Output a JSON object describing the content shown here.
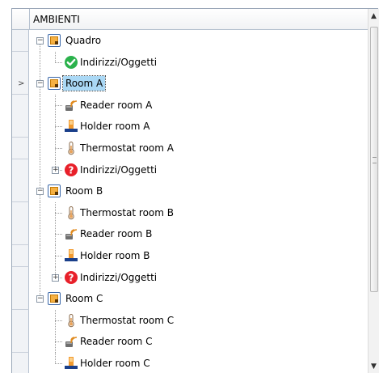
{
  "column_header": "AMBIENTI",
  "rows": [
    {
      "label": "Quadro",
      "kind": "room",
      "level": 0,
      "expanded": true,
      "selected": false
    },
    {
      "label": "Indirizzi/Oggetti",
      "kind": "ok",
      "level": 1,
      "selected": false
    },
    {
      "label": "Room A",
      "kind": "room",
      "level": 0,
      "expanded": true,
      "selected": true
    },
    {
      "label": "Reader room A",
      "kind": "reader",
      "level": 1,
      "selected": false
    },
    {
      "label": "Holder room A",
      "kind": "holder",
      "level": 1,
      "selected": false
    },
    {
      "label": "Thermostat room A",
      "kind": "thermo",
      "level": 1,
      "selected": false
    },
    {
      "label": "Indirizzi/Oggetti",
      "kind": "error",
      "level": 1,
      "collapsed": true,
      "selected": false
    },
    {
      "label": "Room B",
      "kind": "room",
      "level": 0,
      "expanded": true,
      "selected": false
    },
    {
      "label": "Thermostat room B",
      "kind": "thermo",
      "level": 1,
      "selected": false
    },
    {
      "label": "Reader room B",
      "kind": "reader",
      "level": 1,
      "selected": false
    },
    {
      "label": "Holder room B",
      "kind": "holder",
      "level": 1,
      "selected": false
    },
    {
      "label": "Indirizzi/Oggetti",
      "kind": "error",
      "level": 1,
      "collapsed": true,
      "selected": false
    },
    {
      "label": "Room C",
      "kind": "room",
      "level": 0,
      "expanded": true,
      "selected": false
    },
    {
      "label": "Thermostat room C",
      "kind": "thermo",
      "level": 1,
      "selected": false
    },
    {
      "label": "Reader room C",
      "kind": "reader",
      "level": 1,
      "selected": false
    },
    {
      "label": "Holder room C",
      "kind": "holder",
      "level": 1,
      "selected": false
    }
  ],
  "current_row_indicator": ">",
  "icons": {
    "room": "room-icon",
    "ok": "check-icon",
    "error": "question-error-icon",
    "reader": "card-reader-icon",
    "holder": "card-holder-icon",
    "thermo": "thermostat-icon",
    "expand": "expand-icon",
    "collapse": "collapse-icon"
  },
  "colors": {
    "selection": "#aad8f5",
    "ok": "#2bb24c",
    "error": "#e8202a",
    "room_frame": "#3a67a8",
    "room_fill": "#f5b042"
  }
}
